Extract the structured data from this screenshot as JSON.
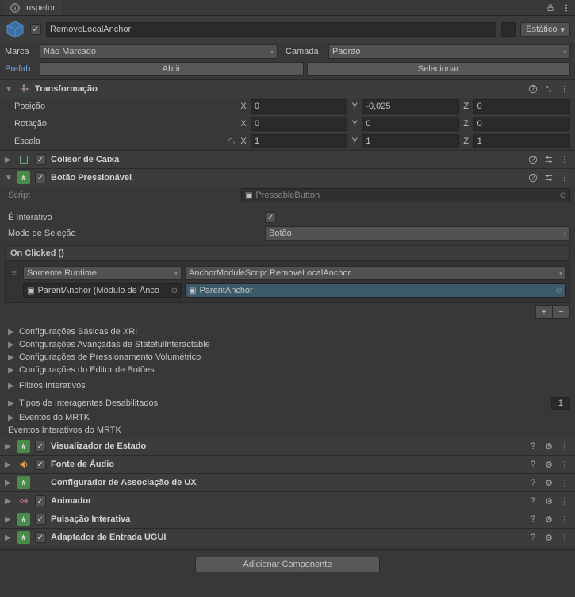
{
  "tab": {
    "title": "Inspetor"
  },
  "header": {
    "object_name": "RemoveLocalAnchor",
    "static_label": "Estático",
    "tag_label": "Marca",
    "tag_value": "Não Marcado",
    "layer_label": "Camada",
    "layer_value": "Padrão",
    "prefab_label": "Prefab",
    "open_btn": "Abrir",
    "select_btn": "Selecionar"
  },
  "transform": {
    "title": "Transformação",
    "position_label": "Posição",
    "position": {
      "x": "0",
      "y": "-0,025",
      "z": "0"
    },
    "rotation_label": "Rotação",
    "rotation": {
      "x": "0",
      "y": "0",
      "z": "0"
    },
    "scale_label": "Escala",
    "scale": {
      "x": "1",
      "y": "1",
      "z": "1"
    },
    "x": "X",
    "y": "Y",
    "z": "Z"
  },
  "boxcollider": {
    "title": "Colisor de Caixa"
  },
  "pressable": {
    "title": "Botão Pressionável",
    "script_label": "Script",
    "script_value": "PressableButton",
    "is_interactive_label": "É Interativo",
    "select_mode_label": "Modo de Seleção",
    "select_mode_value": "Botão"
  },
  "event": {
    "header": "On Clicked ()",
    "runtime_value": "Somente Runtime",
    "function_value": "AnchorModuleScript.RemoveLocalAnchor",
    "target_value": "ParentAnchor (Módulo de Ânco",
    "arg_value": "ParentAnchor"
  },
  "folds": {
    "xri_basic": "Configurações Básicas de XRI",
    "stateful_adv": "Configurações Avançadas de StatefulInteractable",
    "vol_press": "Configurações de Pressionamento Volumétrico",
    "button_editor": "Configurações do Editor de Botões",
    "interactive_filters": "Filtros Interativos",
    "disabled_interactors": "Tipos de Interagentes Desabilitados",
    "disabled_count": "1",
    "mrtk_events": "Eventos do MRTK",
    "mrtk_interactive_events": "Eventos Interativos do MRTK"
  },
  "components": {
    "state_visualizer": "Visualizador de Estado",
    "audio_source": "Fonte de Áudio",
    "ux_binding": "Configurador de Associação de UX",
    "animator": "Animador",
    "interactable_pulse": "Pulsação Interativa",
    "ugui_adapter": "Adaptador de Entrada UGUI"
  },
  "add_component": "Adicionar Componente"
}
